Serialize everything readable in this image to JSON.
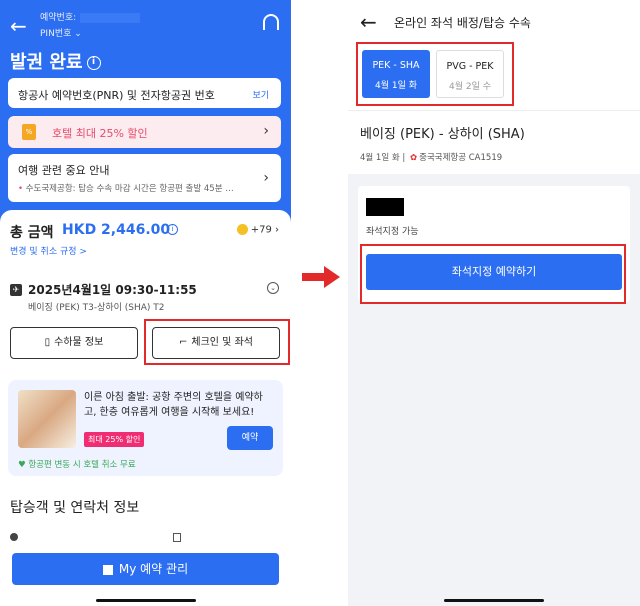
{
  "left": {
    "header": {
      "booking_no_label": "예약번호:",
      "pin_label": "PIN번호",
      "title": "발권 완료",
      "info_icon": "i"
    },
    "pnr": {
      "text": "항공사 예약번호(PNR) 및 전자항공권 번호",
      "link": "보기"
    },
    "promo": {
      "icon": "%",
      "text": "호텔 최대 25% 할인",
      "chevron": "›"
    },
    "notice": {
      "title": "여행 관련 중요 안내",
      "bullet": "•",
      "summary": "수도국제공항: 탑승 수속 마감 시간은 항공편 출발 45분 …",
      "chevron": "›"
    },
    "total": {
      "label": "총 금액",
      "value": "HKD 2,446.00",
      "info": "i",
      "points": "+79",
      "rules": "변경 및 취소 규정 >"
    },
    "flight": {
      "plane": "✈",
      "time": "2025년4월1일  09:30-11:55",
      "route": "베이징 (PEK) T3-상하이 (SHA) T2",
      "expand": "⌄"
    },
    "buttons": {
      "baggage": "수하물 정보",
      "baggage_icon": "▯",
      "checkin": "체크인 및 좌석",
      "checkin_icon": "⌐"
    },
    "hotel": {
      "text": "이른 아침 출발: 공항 주변의 호텔을 예약하고, 한층 여유롭게 여행을 시작해 보세요!",
      "badge": "최대 25% 할인",
      "book": "예약",
      "footer": "♥ 항공편 변동 시 호텔 취소 무료"
    },
    "pax": {
      "title": "탑승객 및 연락처 정보"
    },
    "manage": "My 예약 관리"
  },
  "right": {
    "back": "←",
    "title": "온라인 좌석 배정/탑승 수속",
    "segments": [
      {
        "route": "PEK - SHA",
        "date": "4월 1일 화"
      },
      {
        "route": "PVG - PEK",
        "date": "4월 2일 수"
      }
    ],
    "route": "베이징 (PEK) - 상하이 (SHA)",
    "date": "4월 1일 화  |",
    "airline_logo": "✿",
    "airline": "중국국제항공 CA1519",
    "seat_available": "좌석지정 가능",
    "seat_button": "좌석지정 예약하기"
  },
  "colors": {
    "primary": "#2c6ef2",
    "highlight": "#e32a2a",
    "promo_text": "#e54b6b"
  }
}
